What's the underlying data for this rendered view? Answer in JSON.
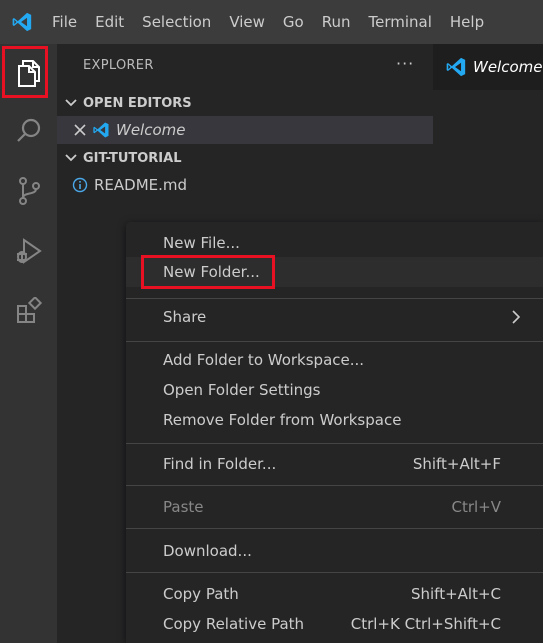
{
  "menubar": {
    "items": [
      "File",
      "Edit",
      "Selection",
      "View",
      "Go",
      "Run",
      "Terminal",
      "Help"
    ]
  },
  "activitybar": {
    "icons": [
      "explorer-icon",
      "search-icon",
      "source-control-icon",
      "run-debug-icon",
      "extensions-icon"
    ]
  },
  "sidebar": {
    "title": "EXPLORER",
    "more": "···",
    "open_editors": {
      "label": "OPEN EDITORS",
      "files": [
        "Welcome"
      ]
    },
    "folder": {
      "label": "GIT-TUTORIAL",
      "files": [
        "README.md"
      ]
    }
  },
  "editor": {
    "tab_label": "Welcome"
  },
  "context_menu": {
    "items": [
      {
        "label": "New File...",
        "shortcut": ""
      },
      {
        "label": "New Folder...",
        "shortcut": ""
      },
      {
        "label": "Share",
        "shortcut": ""
      },
      {
        "label": "Add Folder to Workspace...",
        "shortcut": ""
      },
      {
        "label": "Open Folder Settings",
        "shortcut": ""
      },
      {
        "label": "Remove Folder from Workspace",
        "shortcut": ""
      },
      {
        "label": "Find in Folder...",
        "shortcut": "Shift+Alt+F"
      },
      {
        "label": "Paste",
        "shortcut": "Ctrl+V"
      },
      {
        "label": "Download...",
        "shortcut": ""
      },
      {
        "label": "Copy Path",
        "shortcut": "Shift+Alt+C"
      },
      {
        "label": "Copy Relative Path",
        "shortcut": "Ctrl+K Ctrl+Shift+C"
      }
    ]
  },
  "colors": {
    "accent_highlight": "#e81123",
    "vscode_blue": "#23a9f2"
  }
}
